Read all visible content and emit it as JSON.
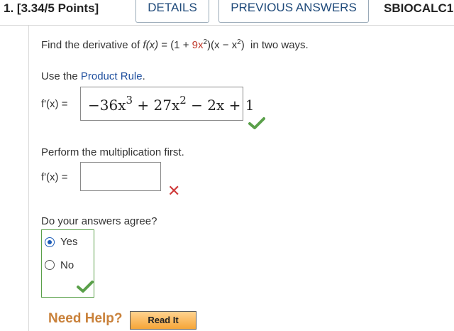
{
  "header": {
    "question_number": "1.",
    "points": "[3.34/5 Points]",
    "details_label": "DETAILS",
    "previous_answers_label": "PREVIOUS ANSWERS",
    "assignment_code": "SBIOCALC1"
  },
  "problem": {
    "prompt_before": "Find the derivative of",
    "fx": "f(x)",
    "eq_open": " = (1 + ",
    "red_coef": "9x",
    "exp2": "2",
    "eq_mid": ")(x − x",
    "eq_close": ")",
    "prompt_after": "in two ways."
  },
  "part1": {
    "instruction_before": "Use the ",
    "link_label": "Product Rule",
    "instruction_after": ".",
    "label": "f'(x) =",
    "answer": {
      "t1": "−36x",
      "e1": "3",
      "t2": " + 27x",
      "e2": "2",
      "t3": " − 2x + 1"
    },
    "status": "correct"
  },
  "part2": {
    "instruction": "Perform the multiplication first.",
    "label": "f'(x) =",
    "answer": "",
    "status": "incorrect"
  },
  "part3": {
    "question": "Do your answers agree?",
    "options": [
      {
        "label": "Yes",
        "selected": true
      },
      {
        "label": "No",
        "selected": false
      }
    ],
    "status": "correct"
  },
  "help": {
    "label": "Need Help?",
    "read_it_label": "Read It"
  },
  "colors": {
    "link": "#1f4f9e",
    "correct": "#5aa04a",
    "incorrect": "#cf3b3b",
    "help": "#c9813a",
    "button_text": "#1f4a7a"
  },
  "icons": {
    "correct": "check-icon",
    "incorrect": "cross-icon"
  }
}
